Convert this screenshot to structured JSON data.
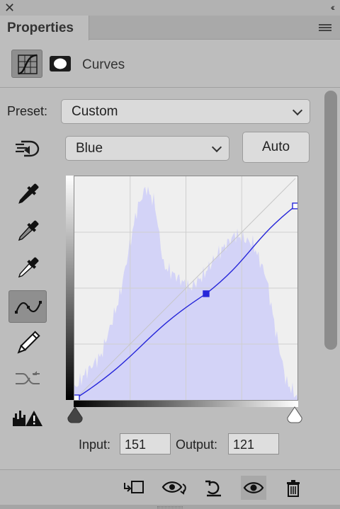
{
  "window": {
    "close_glyph": "✕",
    "collapse_glyph": "‹‹"
  },
  "panel": {
    "tab_title": "Properties"
  },
  "header": {
    "title": "Curves"
  },
  "preset": {
    "label": "Preset:",
    "value": "Custom"
  },
  "channel": {
    "value": "Blue"
  },
  "auto_button": {
    "label": "Auto"
  },
  "tools": [
    {
      "name": "on-image-adjust-icon"
    },
    {
      "name": "black-point-eyedropper-icon"
    },
    {
      "name": "gray-point-eyedropper-icon"
    },
    {
      "name": "white-point-eyedropper-icon"
    },
    {
      "name": "curve-points-icon",
      "selected": true
    },
    {
      "name": "pencil-draw-icon"
    },
    {
      "name": "smooth-curve-icon"
    },
    {
      "name": "clipping-warning-icon"
    }
  ],
  "curve": {
    "channel_color": "#2626d9",
    "histogram_color": "#d3d3f7",
    "control_points": [
      {
        "input": 0,
        "output": 0
      },
      {
        "input": 151,
        "output": 121,
        "selected": true
      },
      {
        "input": 255,
        "output": 223
      }
    ]
  },
  "readout": {
    "input_label": "Input:",
    "input_value": "151",
    "output_label": "Output:",
    "output_value": "121"
  },
  "footer": {
    "icons": [
      "clip-to-layer-icon",
      "view-previous-state-icon",
      "reset-icon",
      "toggle-visibility-icon",
      "delete-icon"
    ]
  }
}
